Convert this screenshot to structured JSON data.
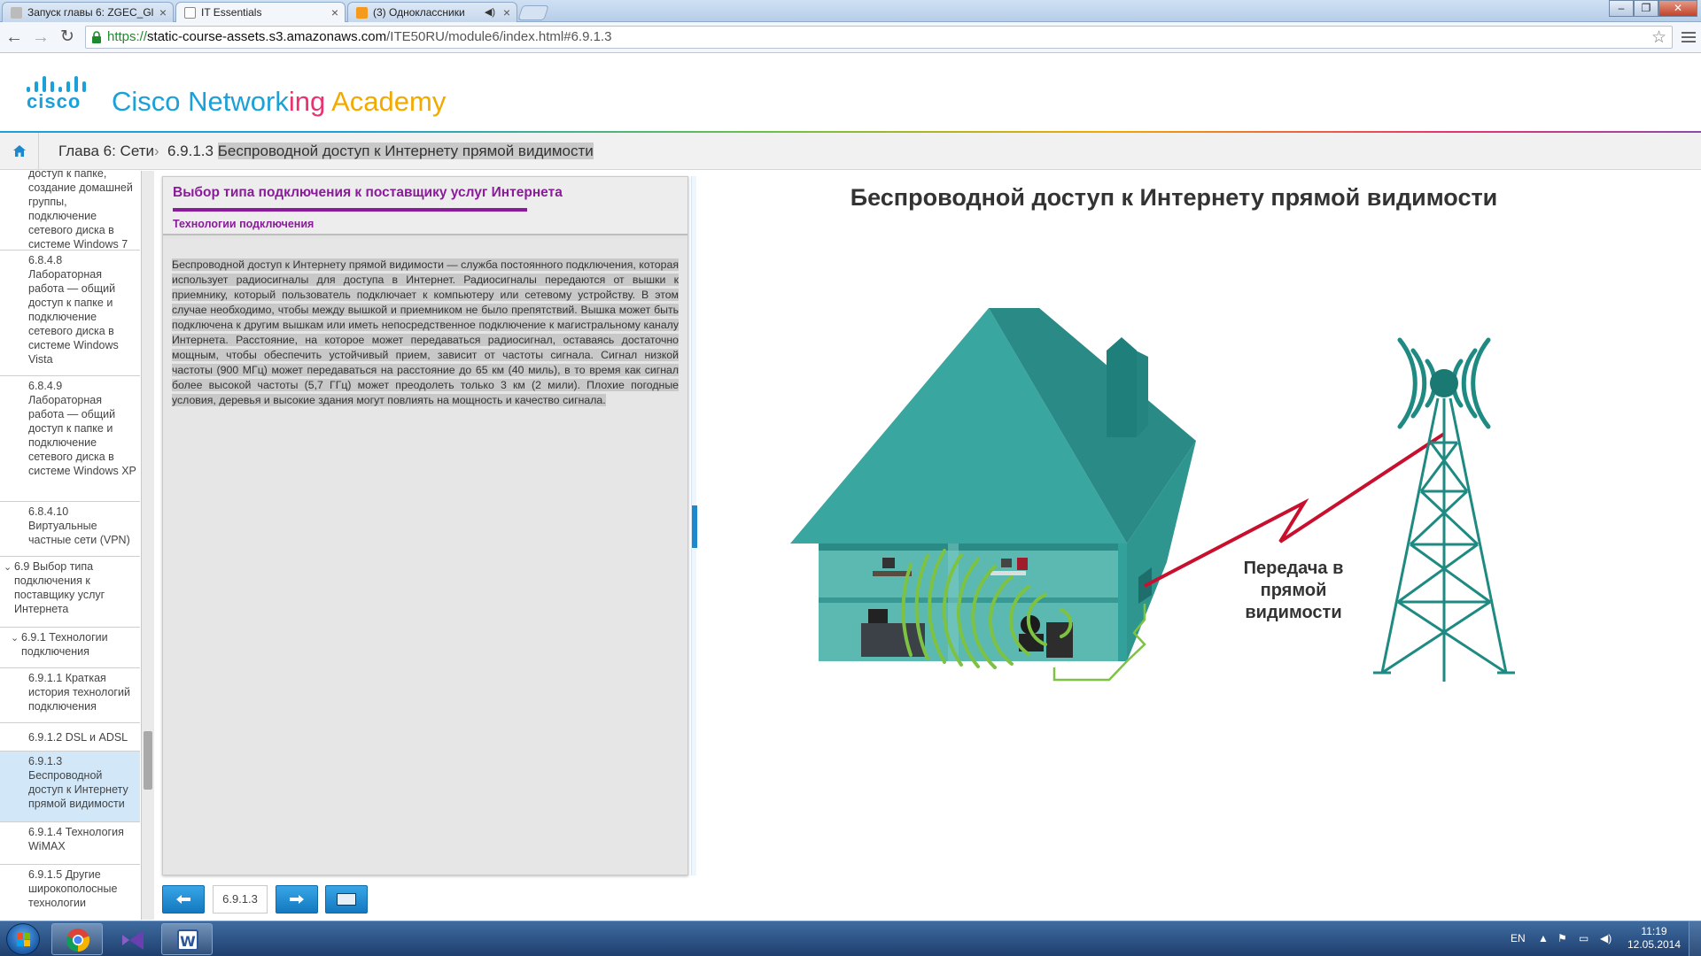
{
  "browser": {
    "tabs": [
      {
        "title": "Запуск главы 6: ZGEC_Gl"
      },
      {
        "title": "IT Essentials"
      },
      {
        "title": "(3) Одноклассники"
      }
    ],
    "url": {
      "scheme": "https://",
      "host": "static-course-assets.s3.amazonaws.com",
      "path": "/ITE50RU/module6/index.html#6.9.1.3"
    }
  },
  "brand": {
    "logo_word": "cisco",
    "academy_words": [
      "Cisco",
      "Network",
      "ing",
      "Academy"
    ],
    "academy_colors": [
      "#1ba0d7",
      "#1ba0d7",
      "#e8336f",
      "#f2a900"
    ]
  },
  "breadcrumb": {
    "chapter": "Глава 6: Сети",
    "sep": "›",
    "section_num": "6.9.1.3",
    "section_title": "Беспроводной доступ к Интернету прямой видимости"
  },
  "toc": {
    "items": [
      {
        "label": "доступ к папке, создание домашней группы, подключение сетевого диска в системе Windows 7"
      },
      {
        "label": "6.8.4.8 Лабораторная работа — общий доступ к папке и подключение сетевого диска в системе Windows Vista"
      },
      {
        "label": "6.8.4.9 Лабораторная работа — общий доступ к папке и подключение сетевого диска в системе Windows XP"
      },
      {
        "label": "6.8.4.10 Виртуальные частные сети (VPN)"
      },
      {
        "label": "6.9 Выбор типа подключения к поставщику услуг Интернета"
      },
      {
        "label": "6.9.1 Технологии подключения"
      },
      {
        "label": "6.9.1.1 Краткая история технологий подключения"
      },
      {
        "label": "6.9.1.2 DSL и ADSL"
      },
      {
        "label": "6.9.1.3 Беспроводной доступ к Интернету прямой видимости"
      },
      {
        "label": "6.9.1.4 Технология WiMAX"
      },
      {
        "label": "6.9.1.5 Другие широкополосные технологии"
      }
    ]
  },
  "panel": {
    "title": "Выбор типа подключения к поставщику услуг Интернета",
    "subtitle": "Технологии подключения",
    "body": "Беспроводной доступ к Интернету прямой видимости — служба постоянного подключения, которая использует радиосигналы для доступа в Интернет. Радиосигналы передаются от вышки к приемнику, который пользователь подключает к компьютеру или сетевому устройству. В этом случае необходимо, чтобы между вышкой и приемником не было препятствий. Вышка может быть подключена к другим вышкам или иметь непосредственное подключение к магистральному каналу Интернета. Расстояние, на которое может передаваться радиосигнал, оставаясь достаточно мощным, чтобы обеспечить устойчивый прием, зависит от частоты сигнала. Сигнал низкой частоты (900 МГц) может передаваться на расстояние до 65 км (40 миль), в то время как сигнал более высокой частоты (5,7 ГГц) может преодолеть только 3 км (2 мили). Плохие погодные условия, деревья и высокие здания могут повлиять на мощность и качество сигнала."
  },
  "nav": {
    "page": "6.9.1.3"
  },
  "illustration": {
    "title": "Беспроводной доступ к Интернету прямой видимости",
    "caption_lines": [
      "Передача в",
      "прямой",
      "видимости"
    ]
  },
  "taskbar": {
    "lang": "EN",
    "time": "11:19",
    "date": "12.05.2014"
  },
  "colors": {
    "house": "#3aa6a0",
    "house_dark": "#2a8a86",
    "tower": "#1f8a82",
    "signal_red": "#c8102e",
    "wifi_green": "#7dc242",
    "accent_purple": "#8a1b9a",
    "nav_blue": "#1e88cc"
  }
}
